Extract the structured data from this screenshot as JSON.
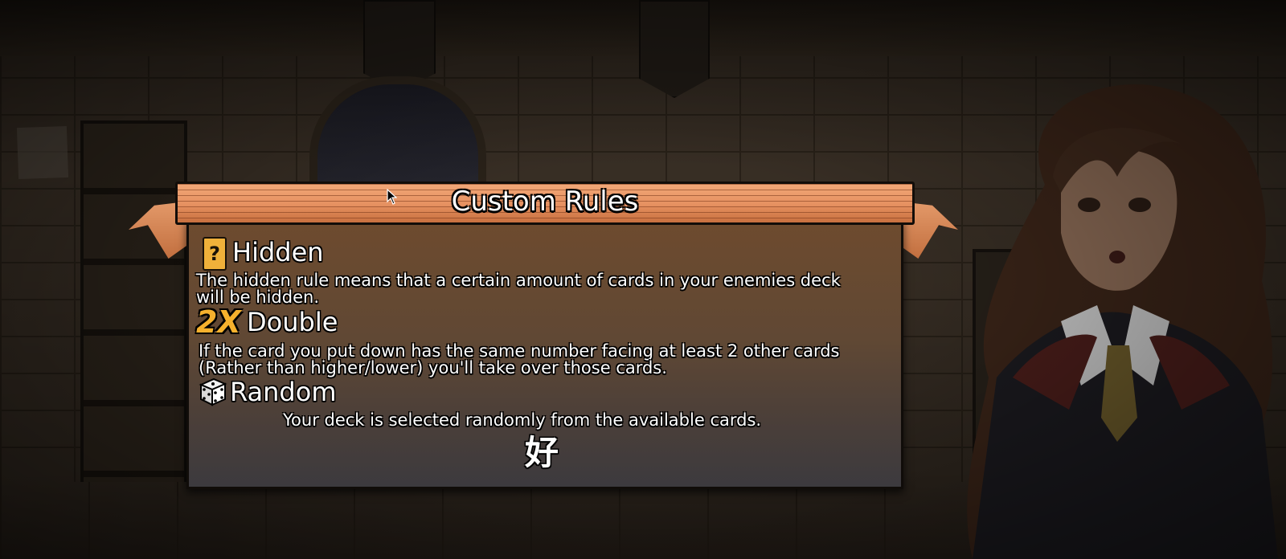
{
  "dialog": {
    "title": "Custom Rules",
    "rules": [
      {
        "icon": "question-mark-card-icon",
        "name": "Hidden",
        "description": "The hidden rule means that a certain amount of cards in your enemies deck\nwill be hidden."
      },
      {
        "icon": "2x-icon",
        "icon_text": "2X",
        "name": "Double",
        "description": "If the card you put down has the same number facing at least 2 other cards\n(Rather than higher/lower) you'll take over those cards."
      },
      {
        "icon": "dice-icon",
        "name": "Random",
        "description": "Your deck is selected randomly from the available cards."
      }
    ],
    "confirm_label": "好"
  },
  "colors": {
    "ribbon": "#e59060",
    "panel_top": "#6e4b2e",
    "panel_bottom": "#3c3a3e",
    "hidden_icon": "#f0b13a",
    "double_icon": "#f6b12d"
  }
}
